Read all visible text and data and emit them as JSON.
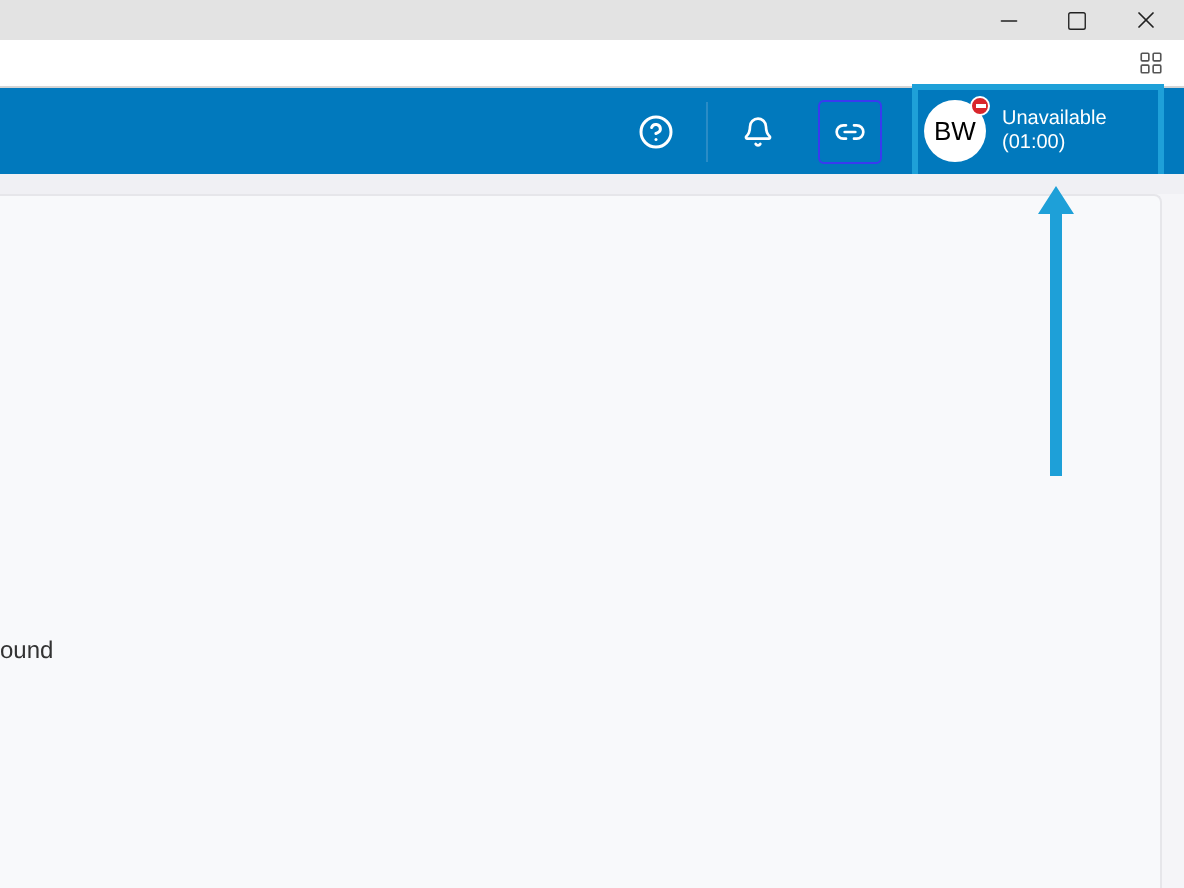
{
  "header": {
    "profile": {
      "initials": "BW",
      "status": "Unavailable",
      "timer": "(01:00)"
    }
  },
  "content": {
    "text": "ound"
  }
}
